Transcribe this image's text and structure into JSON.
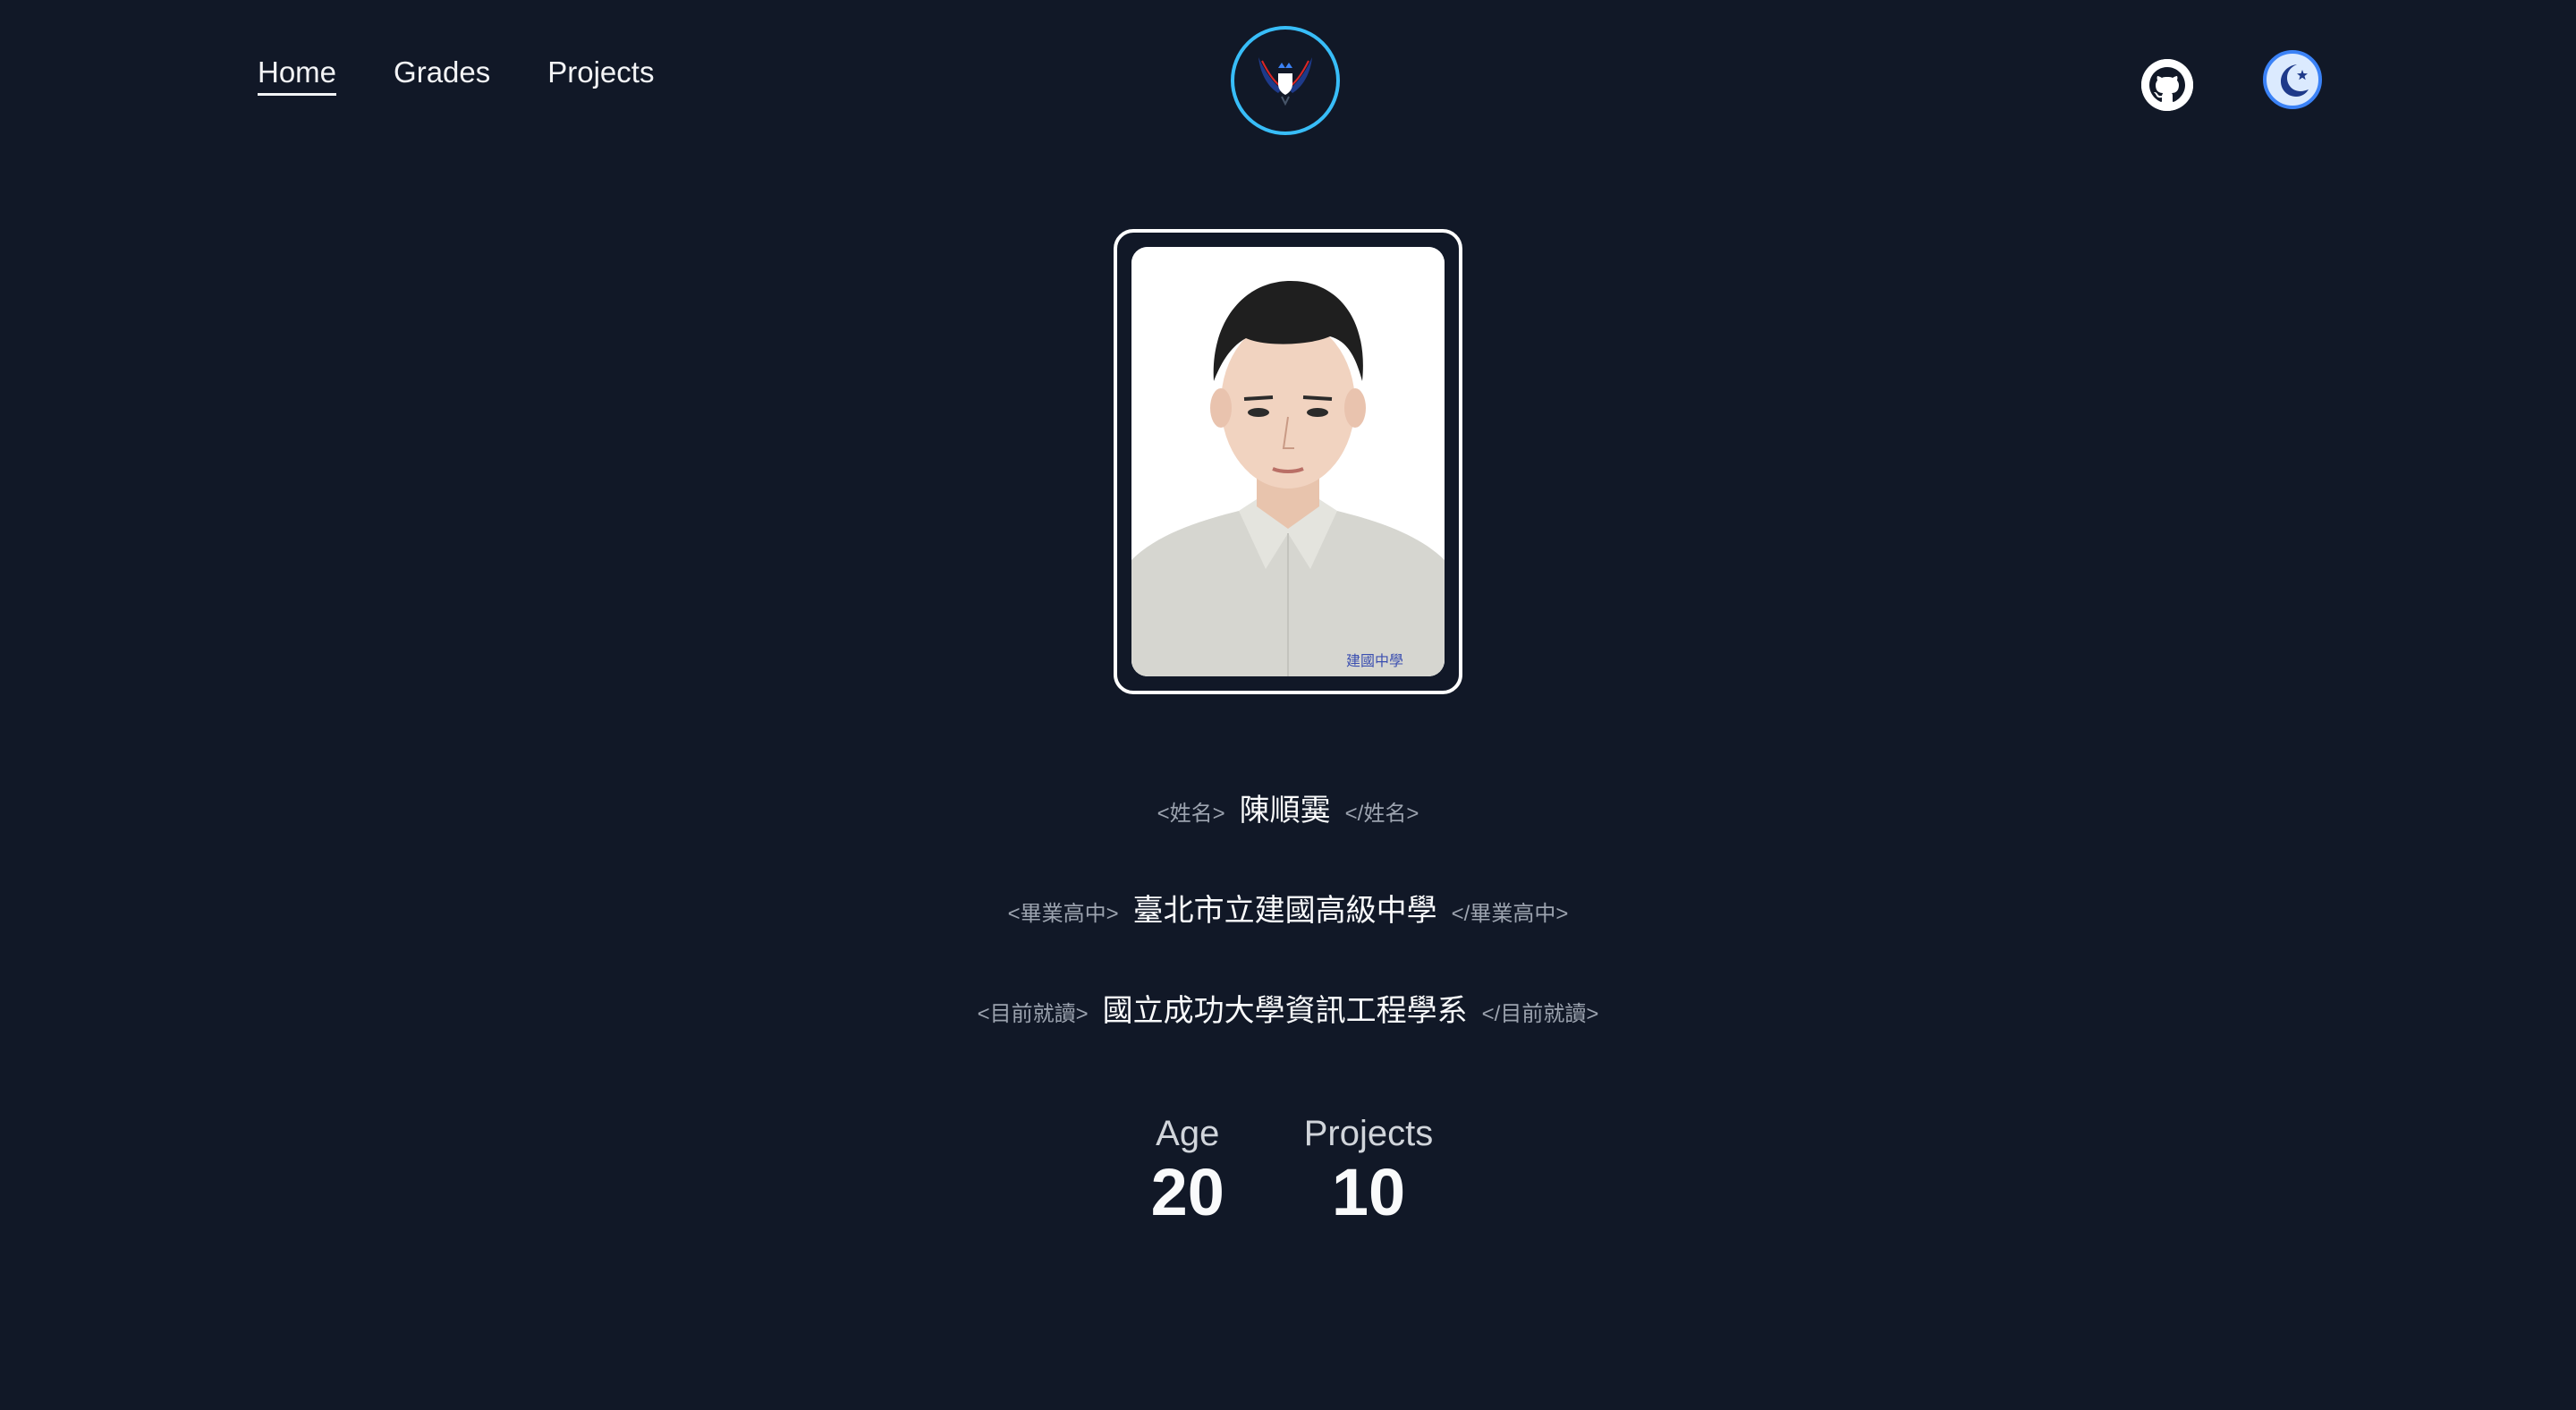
{
  "nav": {
    "items": [
      {
        "label": "Home",
        "active": true
      },
      {
        "label": "Grades",
        "active": false
      },
      {
        "label": "Projects",
        "active": false
      }
    ]
  },
  "logo": {
    "icon": "eagle-emblem-icon",
    "ring_color": "#38bdf8"
  },
  "header_icons": {
    "github": "github-icon",
    "theme_toggle": "moon-star-icon"
  },
  "profile": {
    "name": {
      "open_tag": "<姓名>",
      "value": "陳順霙",
      "close_tag": "</姓名>"
    },
    "high_school": {
      "open_tag": "<畢業高中>",
      "value": "臺北市立建國高級中學",
      "close_tag": "</畢業高中>"
    },
    "current_school": {
      "open_tag": "<目前就讀>",
      "value": "國立成功大學資訊工程學系",
      "close_tag": "</目前就讀>"
    },
    "photo_stamp": "建國中學"
  },
  "stats": [
    {
      "label": "Age",
      "value": "20"
    },
    {
      "label": "Projects",
      "value": "10"
    }
  ],
  "colors": {
    "background": "#111827",
    "text": "#f3f4f6",
    "muted": "#9ca3af",
    "accent": "#38bdf8"
  }
}
